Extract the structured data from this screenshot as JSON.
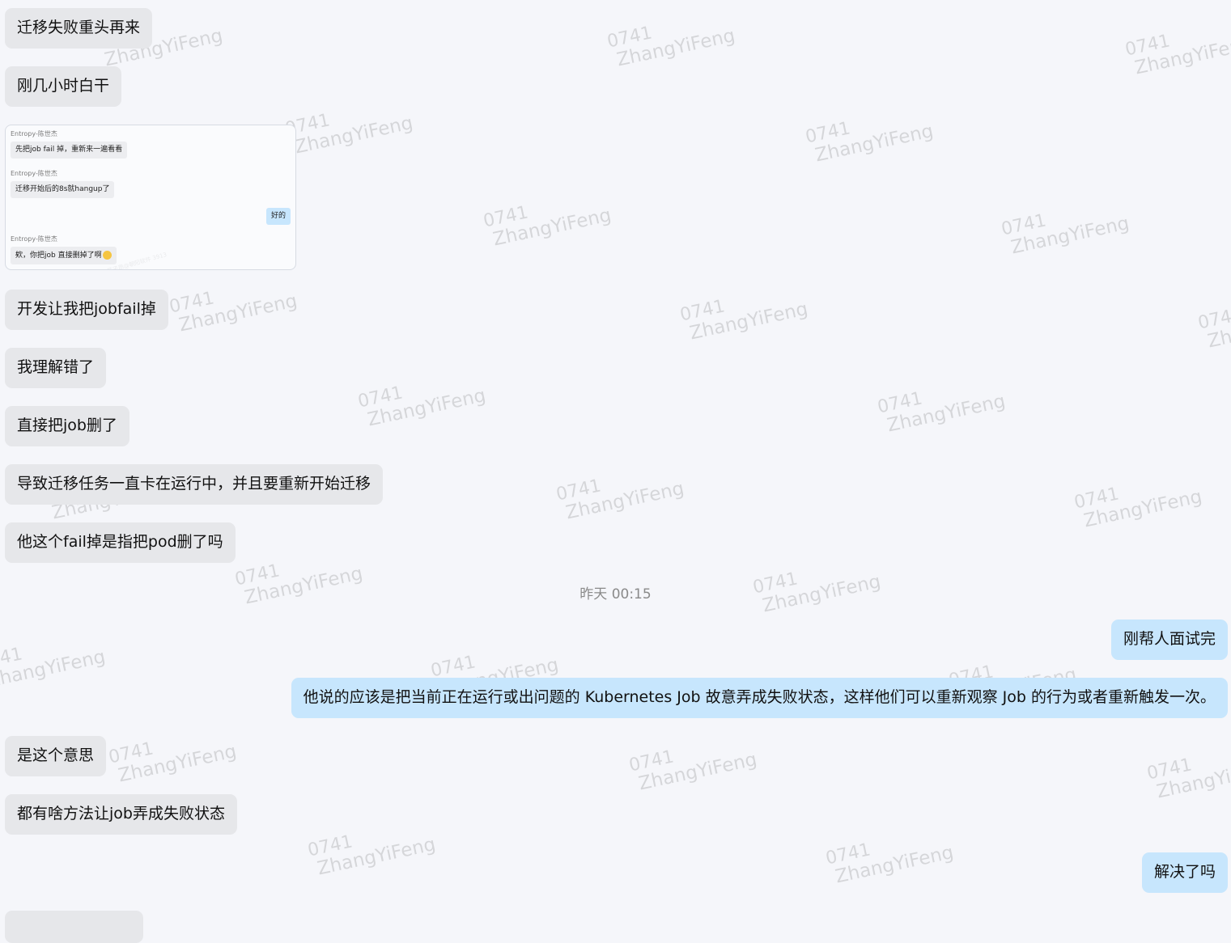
{
  "messages": {
    "m1": "迁移失败重头再来",
    "m2": "刚几小时白干",
    "m3": "开发让我把jobfail掉",
    "m4": "我理解错了",
    "m5": "直接把job删了",
    "m6": "导致迁移任务一直卡在运行中，并且要重新开始迁移",
    "m7": "他这个fail掉是指把pod删了吗",
    "m8": "刚帮人面试完",
    "m9": "他说的应该是把当前正在运行或出问题的 Kubernetes Job 故意弄成失败状态，这样他们可以重新观察 Job 的行为或者重新触发一次。",
    "m10": "是这个意思",
    "m11": "都有啥方法让job弄成失败状态",
    "m12": "解决了吗"
  },
  "timestamp": "昨天 00:15",
  "embedded_screenshot": {
    "sender1": "Entropy-陈世杰",
    "msg1": "先把job fail 掉，重新来一遍看看",
    "sender2": "Entropy-陈世杰",
    "msg2": "迁移开始后的8s就hangup了",
    "reply": "好的",
    "sender3": "Entropy-陈世杰",
    "msg3": "欸，你把job 直接删掉了啊",
    "watermark": "Ziang Liu-苏子昂@朝阳软件 3913"
  },
  "watermark": {
    "line1": "0741",
    "line2": "ZhangYiFeng"
  },
  "colors": {
    "background": "#f5f6fa",
    "incoming_bubble": "#e6e7ea",
    "outgoing_bubble": "#c7e6fd"
  }
}
